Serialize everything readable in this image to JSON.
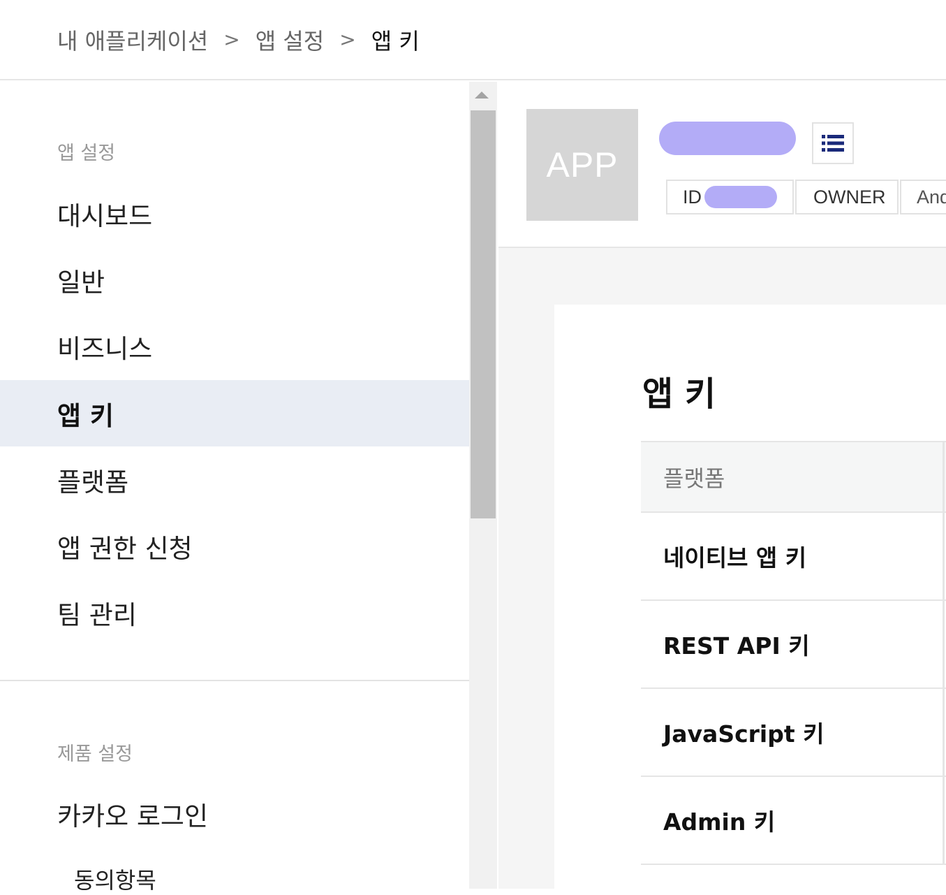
{
  "breadcrumb": {
    "items": [
      "내 애플리케이션",
      "앱 설정",
      "앱 키"
    ],
    "separator": ">"
  },
  "sidebar": {
    "group1_title": "앱 설정",
    "items": [
      "대시보드",
      "일반",
      "비즈니스",
      "앱 키",
      "플랫폼",
      "앱 권한 신청",
      "팀 관리"
    ],
    "active_item": "앱 키",
    "group2_title": "제품 설정",
    "product_items": [
      "카카오 로그인"
    ],
    "product_subitems": [
      "동의항목"
    ]
  },
  "app_header": {
    "thumbnail_text": "APP",
    "tags": [
      "ID",
      "OWNER",
      "And"
    ],
    "menu_icon": "list-icon"
  },
  "card": {
    "title": "앱 키",
    "table_header": "플랫폼",
    "rows": [
      "네이티브 앱 키",
      "REST API 키",
      "JavaScript 키",
      "Admin 키"
    ]
  },
  "colors": {
    "active_bg": "#e9edf4",
    "redaction": "#b3acf7",
    "menu_icon": "#1a2a7a"
  }
}
